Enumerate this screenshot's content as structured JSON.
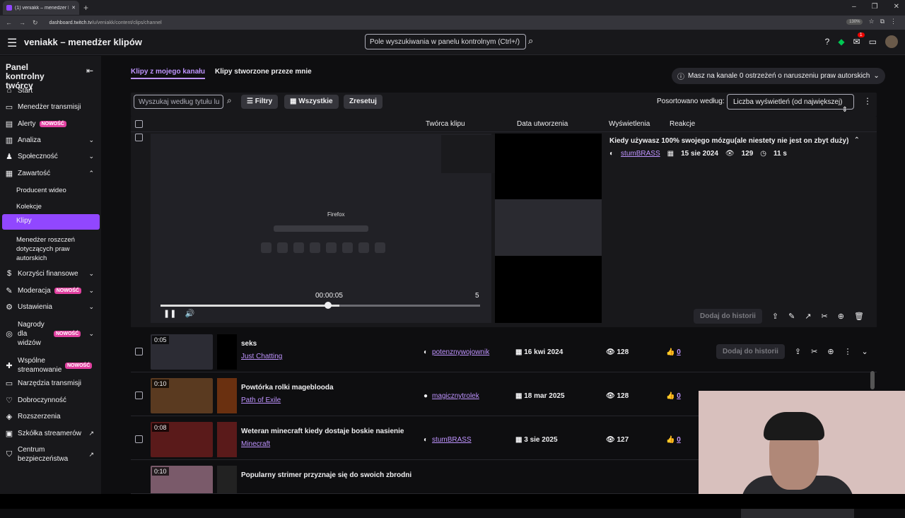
{
  "browser": {
    "tab_title": "(1) veniakk – menedżer klip",
    "url_domain": "dashboard.twitch.tv",
    "url_path": "/u/veniakk/content/clips/channel",
    "zoom": "130%",
    "notif_count": "1"
  },
  "top": {
    "title": "veniakk – menedżer klipów",
    "search_placeholder": "Pole wyszukiwania w panelu kontrolnym (Ctrl+/)"
  },
  "sidebar": {
    "header": "Panel kontrolny twórcy",
    "new": "NOWOŚĆ",
    "items": [
      {
        "label": "Start",
        "icon": "⌂"
      },
      {
        "label": "Menedżer transmisji",
        "icon": "▭"
      },
      {
        "label": "Alerty",
        "icon": "▤"
      },
      {
        "label": "Analiza",
        "icon": "▥"
      },
      {
        "label": "Społeczność",
        "icon": "♟"
      },
      {
        "label": "Zawartość",
        "icon": "▦"
      },
      {
        "label": "Korzyści finansowe",
        "icon": "$"
      },
      {
        "label": "Moderacja",
        "icon": "✎"
      },
      {
        "label": "Ustawienia",
        "icon": "⚙"
      },
      {
        "label": "Nagrody dla widzów",
        "icon": "◎"
      },
      {
        "label": "Wspólne streamowanie",
        "icon": "✚"
      },
      {
        "label": "Narzędzia transmisji",
        "icon": "▭"
      },
      {
        "label": "Dobroczynność",
        "icon": "♡"
      },
      {
        "label": "Rozszerzenia",
        "icon": "◈"
      },
      {
        "label": "Szkółka streamerów",
        "icon": "▣"
      },
      {
        "label": "Centrum bezpieczeństwa",
        "icon": "⛉"
      }
    ],
    "sub": [
      "Producent wideo",
      "Kolekcje",
      "Klipy",
      "Menedżer roszczeń dotyczących praw autorskich"
    ]
  },
  "main": {
    "tab1": "Klipy z mojego kanału",
    "tab2": "Klipy stworzone przeze mnie",
    "warning": "Masz na kanale 0 ostrzeżeń o naruszeniu praw autorskich",
    "filter_placeholder": "Wyszukaj według tytułu lu",
    "filters": "Filtry",
    "all": "Wszystkie",
    "reset": "Zresetuj",
    "sort_label": "Posortowano według:",
    "sort_value": "Liczba wyświetleń (od największej)",
    "cols": {
      "creator": "Twórca klipu",
      "date": "Data utworzenia",
      "views": "Wyświetlenia",
      "reactions": "Reakcje"
    },
    "add_history": "Dodaj do historii"
  },
  "expanded": {
    "title": "Kiedy używasz 100% swojego mózgu(ale niestety nie jest on zbyt duży)",
    "creator": "stumBRASS",
    "date": "15 sie 2024",
    "views": "129",
    "duration": "11 s",
    "time": "00:00:05",
    "counter": "5",
    "video_label": "Firefox"
  },
  "rows": [
    {
      "dur": "0:05",
      "title": "seks",
      "cat": "Just Chatting",
      "creator": "potenznywojownik",
      "date": "16 kwi 2024",
      "views": "128",
      "react": "0"
    },
    {
      "dur": "0:10",
      "title": "Powtórka rolki mageblooda",
      "cat": "Path of Exile",
      "creator": "magicznytrolek",
      "date": "18 mar 2025",
      "views": "128",
      "react": "0"
    },
    {
      "dur": "0:08",
      "title": "Weteran minecraft kiedy dostaje boskie nasienie",
      "cat": "Minecraft",
      "creator": "stumBRASS",
      "date": "3 sie 2025",
      "views": "127",
      "react": "0"
    },
    {
      "dur": "0:10",
      "title": "Popularny strimer przyznaje się do swoich zbrodni",
      "cat": "",
      "creator": "",
      "date": "",
      "views": "",
      "react": ""
    }
  ]
}
